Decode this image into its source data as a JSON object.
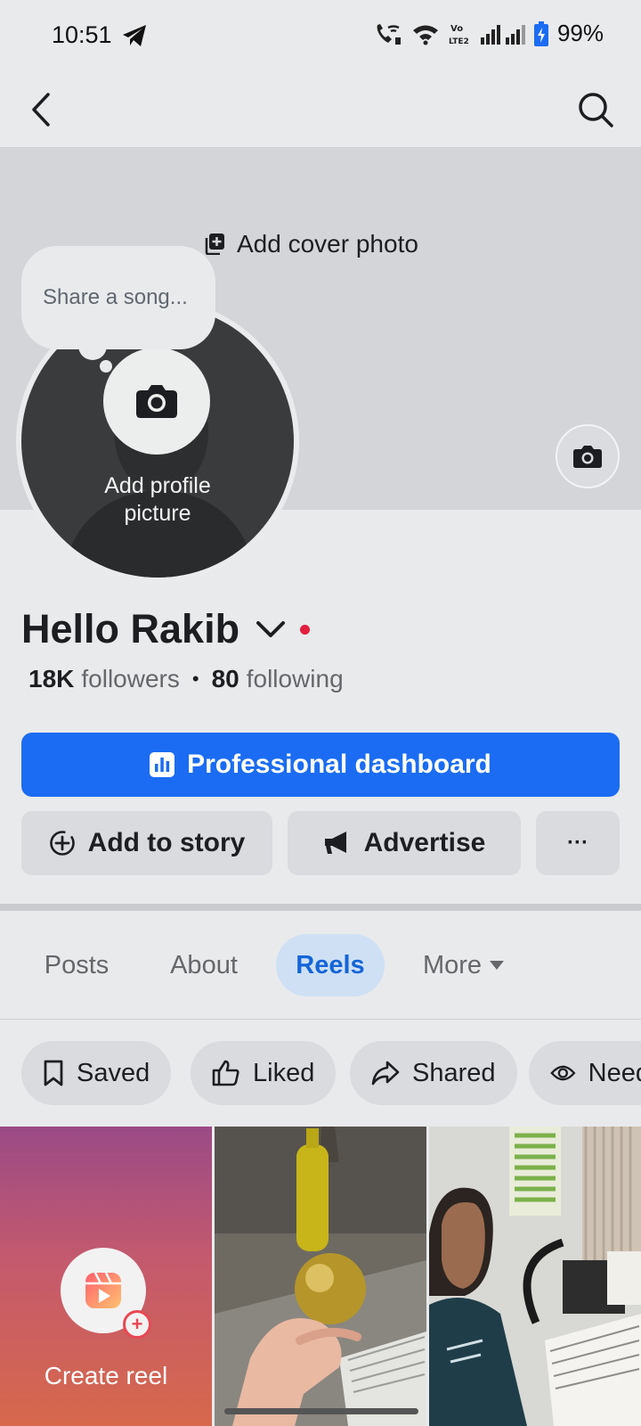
{
  "status_bar": {
    "time": "10:51",
    "battery": "99%"
  },
  "cover": {
    "add_cover_label": "Add cover photo"
  },
  "profile": {
    "song_prompt": "Share a song...",
    "add_picture_line1": "Add profile",
    "add_picture_line2": "picture",
    "name": "Hello Rakib",
    "followers_count": "18K",
    "followers_label": "followers",
    "following_count": "80",
    "following_label": "following"
  },
  "actions": {
    "professional_dashboard": "Professional dashboard",
    "add_to_story": "Add to story",
    "advertise": "Advertise",
    "more": "···"
  },
  "tabs": [
    {
      "label": "Posts",
      "active": false
    },
    {
      "label": "About",
      "active": false
    },
    {
      "label": "Reels",
      "active": true
    },
    {
      "label": "More",
      "active": false
    }
  ],
  "filters": [
    {
      "label": "Saved",
      "icon": "bookmark-icon"
    },
    {
      "label": "Liked",
      "icon": "thumbs-up-icon"
    },
    {
      "label": "Shared",
      "icon": "share-icon"
    },
    {
      "label": "Need",
      "icon": "eye-icon"
    }
  ],
  "grid": {
    "create_reel_label": "Create reel"
  },
  "colors": {
    "accent": "#1b6cf2",
    "active_tab_bg": "#cfe0f5",
    "active_tab_text": "#1565d8",
    "notification_dot": "#e41e3f"
  }
}
